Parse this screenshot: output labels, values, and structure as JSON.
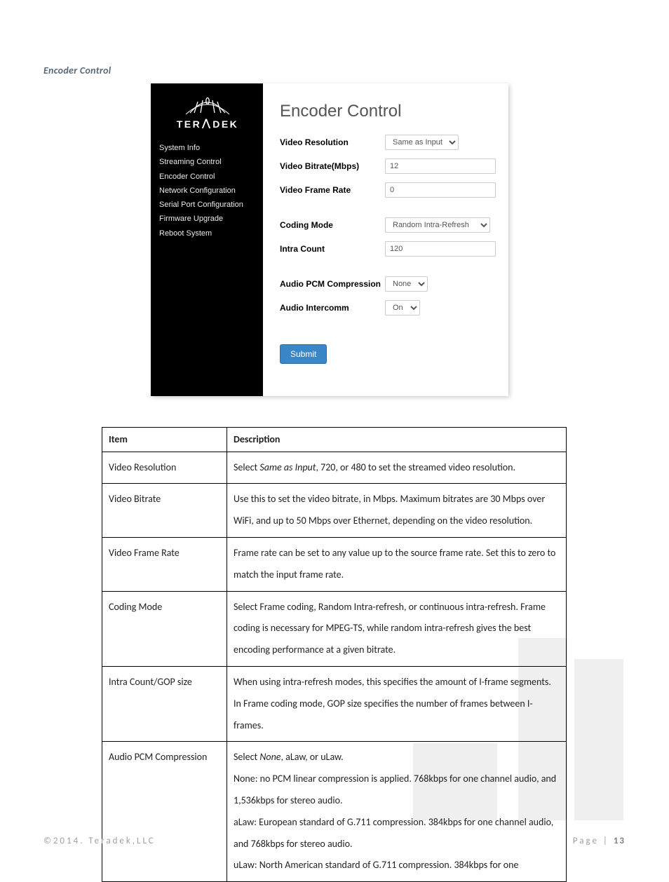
{
  "section_title": "Encoder Control",
  "logo": {
    "brand": "TERADEK"
  },
  "sidebar": {
    "items": [
      {
        "label": "System Info"
      },
      {
        "label": "Streaming Control"
      },
      {
        "label": "Encoder Control"
      },
      {
        "label": "Network Configuration"
      },
      {
        "label": "Serial Port Configuration"
      },
      {
        "label": "Firmware Upgrade"
      },
      {
        "label": "Reboot System"
      }
    ]
  },
  "page": {
    "heading": "Encoder Control",
    "fields": {
      "video_resolution": {
        "label": "Video Resolution",
        "value": "Same as Input"
      },
      "video_bitrate": {
        "label": "Video Bitrate(Mbps)",
        "value": "12"
      },
      "video_framerate": {
        "label": "Video Frame Rate",
        "value": "0"
      },
      "coding_mode": {
        "label": "Coding Mode",
        "value": "Random Intra-Refresh"
      },
      "intra_count": {
        "label": "Intra Count",
        "value": "120"
      },
      "audio_pcm": {
        "label": "Audio PCM Compression",
        "value": "None"
      },
      "audio_intercomm": {
        "label": "Audio Intercomm",
        "value": "On"
      }
    },
    "submit": "Submit"
  },
  "table": {
    "headers": {
      "item": "Item",
      "description": "Description"
    },
    "rows": [
      {
        "item": "Video Resolution",
        "desc_pre": "Select ",
        "desc_i": "Same as Input",
        "desc_post": ", 720, or 480 to set the streamed video resolution."
      },
      {
        "item": "Video Bitrate",
        "desc": "Use this to set the video bitrate, in Mbps. Maximum bitrates are 30 Mbps over WiFi, and up to 50 Mbps over Ethernet, depending on the video resolution."
      },
      {
        "item": "Video Frame Rate",
        "desc": "Frame rate can be set to any value up to the source frame rate. Set this to zero to match the input frame rate."
      },
      {
        "item": "Coding Mode",
        "desc": "Select Frame coding, Random Intra-refresh, or continuous intra-refresh. Frame coding is necessary for MPEG-TS, while random intra-refresh gives the best encoding performance at a given bitrate."
      },
      {
        "item": "Intra Count/GOP size",
        "desc": "When using intra-refresh modes, this specifies the amount of I-frame segments. In Frame coding mode, GOP size specifies the number of frames between I-frames."
      },
      {
        "item": "Audio PCM Compression",
        "desc_pre": "Select ",
        "desc_i": "None",
        "desc_post": ", aLaw, or uLaw.",
        "lines": [
          "None: no PCM linear compression is applied. 768kbps for one channel audio, and 1,536kbps for stereo audio.",
          "aLaw: European standard of G.711 compression. 384kbps for one channel audio, and 768kbps for stereo audio.",
          "uLaw: North American standard of G.711 compression. 384kbps for one"
        ]
      }
    ]
  },
  "footer": {
    "copyright": "©2014. Teradek,LLC",
    "page_label": "Page | ",
    "page_number": "13"
  }
}
